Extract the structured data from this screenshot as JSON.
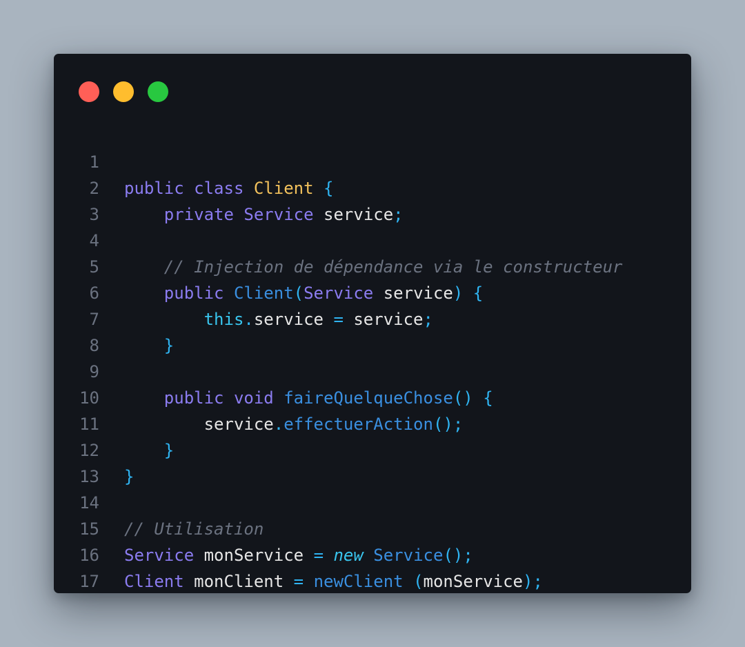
{
  "window": {
    "controls": [
      {
        "name": "close",
        "color": "#ff5f57"
      },
      {
        "name": "minimize",
        "color": "#ffbd2e"
      },
      {
        "name": "maximize",
        "color": "#28c840"
      }
    ]
  },
  "colors": {
    "keyword": "#8b7cf0",
    "class_name": "#f2c15c",
    "punctuation": "#2fb4f2",
    "function": "#3a8fe0",
    "comment": "#6b7280",
    "text": "#e6e6e6",
    "background": "#12151b"
  },
  "code": {
    "line_numbers": [
      "1",
      "2",
      "3",
      "4",
      "5",
      "6",
      "7",
      "8",
      "9",
      "10",
      "11",
      "12",
      "13",
      "14",
      "15",
      "16",
      "17"
    ],
    "l1": {
      "kw1": "public",
      "kw2": "class",
      "cls": "Client",
      "brace": "{"
    },
    "l2": {
      "kw": "private",
      "type": "Service",
      "ident": "service",
      "semi": ";"
    },
    "l4": {
      "comment": "// Injection de dépendance via le constructeur"
    },
    "l5": {
      "kw": "public",
      "ctor": "Client",
      "lp": "(",
      "type": "Service",
      "ident": "service",
      "rp": ")",
      "brace": "{"
    },
    "l6": {
      "this": "this",
      "dot": ".",
      "field": "service",
      "eq": "=",
      "ident": "service",
      "semi": ";"
    },
    "l7": {
      "brace": "}"
    },
    "l9": {
      "kw1": "public",
      "kw2": "void",
      "method": "faireQuelqueChose",
      "parens": "()",
      "brace": "{"
    },
    "l10": {
      "ident": "service",
      "dot": ".",
      "method": "effectuerAction",
      "parens": "()",
      "semi": ";"
    },
    "l11": {
      "brace": "}"
    },
    "l12": {
      "brace": "}"
    },
    "l14": {
      "comment": "// Utilisation"
    },
    "l15": {
      "type": "Service",
      "ident": "monService",
      "eq": "=",
      "new": "new",
      "ctor": "Service",
      "parens": "()",
      "semi": ";"
    },
    "l16": {
      "type": "Client",
      "ident": "monClient",
      "eq": "=",
      "ctor": "newClient",
      "lp": "(",
      "arg": "monService",
      "rp": ")",
      "semi": ";"
    }
  }
}
